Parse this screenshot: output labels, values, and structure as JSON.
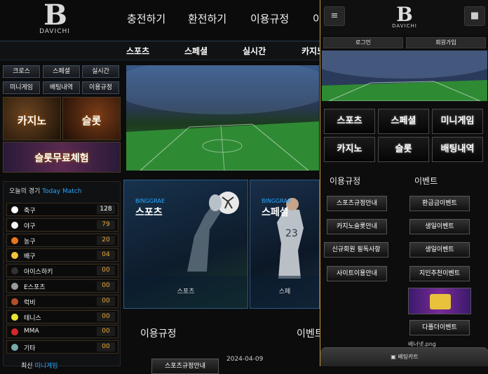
{
  "brand": {
    "letter": "B",
    "name": "DAVICHI"
  },
  "top_nav": [
    "충전하기",
    "환전하기",
    "이용규정",
    "이"
  ],
  "sub_nav": [
    "스포츠",
    "스페셜",
    "실시간",
    "카지노"
  ],
  "left_buttons": [
    "크로스",
    "스페셜",
    "실시간",
    "미니게임",
    "배팅내역",
    "이용규정"
  ],
  "left_tiles": {
    "casino": "카지노",
    "slot": "슬롯",
    "slot_free": "슬롯무료체험"
  },
  "today_match": {
    "title": "오늘의 경기",
    "title_en": "Today Match",
    "items": [
      {
        "name": "축구",
        "count": "128",
        "color": "#ffffff"
      },
      {
        "name": "야구",
        "count": "79",
        "color": "#f4f4f4"
      },
      {
        "name": "농구",
        "count": "20",
        "color": "#e8761e"
      },
      {
        "name": "배구",
        "count": "04",
        "color": "#f0c43a"
      },
      {
        "name": "아이스하키",
        "count": "00",
        "color": "#333333"
      },
      {
        "name": "E스포츠",
        "count": "00",
        "color": "#9a9a9a"
      },
      {
        "name": "럭비",
        "count": "00",
        "color": "#b0502a"
      },
      {
        "name": "테니스",
        "count": "00",
        "color": "#e6e634"
      },
      {
        "name": "MMA",
        "count": "00",
        "color": "#d42828"
      },
      {
        "name": "기타",
        "count": "00",
        "color": "#7aa"
      }
    ]
  },
  "cards": [
    {
      "brand": "BINGGRAE",
      "title": "스포츠",
      "footer": "스포츠"
    },
    {
      "brand": "BINGGRAE",
      "title": "스페셜",
      "footer": "스페"
    }
  ],
  "main_sections": {
    "rules": "이용규정",
    "events": "이벤트",
    "date": "2024-04-09",
    "rule_btn": "스포츠규정안내",
    "bottom_label": "최신",
    "bottom_label2": "미니게임"
  },
  "right_panel": {
    "login": "로그인",
    "signup": "회원가입",
    "grid": [
      "스포츠",
      "스페셜",
      "미니게임",
      "카지노",
      "슬롯",
      "배팅내역"
    ],
    "rules_title": "이용규정",
    "events_title": "이벤트",
    "rules": [
      "스포츠규정안내",
      "카지노슬롯안내",
      "신규회원 필독사항",
      "사이트이용안내"
    ],
    "events": [
      "환급금이벤트",
      "생일이벤트",
      "생일이벤트",
      "지인추천이벤트",
      "다폴더이벤트"
    ],
    "broken_img": "배너넷.png",
    "bet_cart": "배팅카트"
  }
}
